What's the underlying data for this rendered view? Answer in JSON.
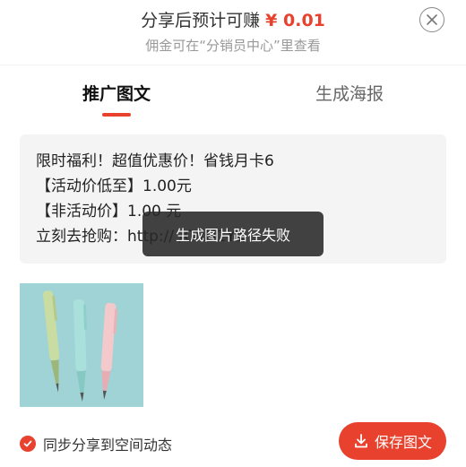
{
  "header": {
    "earn_prefix": "分享后预计可赚",
    "earn_amount": "¥ 0.01",
    "subtitle": "佣金可在“分销员中心”里查看",
    "close_icon": "close-circle-icon"
  },
  "tabs": [
    {
      "label": "推广图文",
      "active": true
    },
    {
      "label": "生成海报",
      "active": false
    }
  ],
  "copy": {
    "line1": "限时福利！超值优惠价！省钱月卡6",
    "line2": "【活动价低至】1.00元",
    "line3": "【非活动价】1.00 元",
    "line4": "立刻去抢购：http://         /CRH1Ys"
  },
  "toast": {
    "text": "生成图片路径失败"
  },
  "sync": {
    "label": "同步分享到空间动态",
    "checked": true
  },
  "save_button": {
    "label": "保存图文",
    "icon": "download-icon"
  },
  "colors": {
    "accent": "#e8412e",
    "image_bg": "#9fd3d6"
  }
}
